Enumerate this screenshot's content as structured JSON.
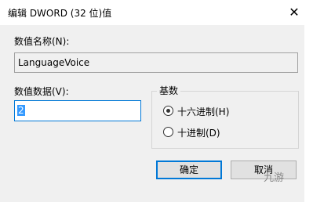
{
  "dialog": {
    "title": "编辑 DWORD (32 位)值",
    "close_glyph": "✕"
  },
  "value_name": {
    "label": "数值名称(N):",
    "value": "LanguageVoice"
  },
  "value_data": {
    "label": "数值数据(V):",
    "value": "2"
  },
  "base": {
    "title": "基数",
    "options": [
      {
        "label": "十六进制(H)",
        "checked": true
      },
      {
        "label": "十进制(D)",
        "checked": false
      }
    ]
  },
  "buttons": {
    "ok": "确定",
    "cancel": "取消"
  },
  "watermark": "九游"
}
